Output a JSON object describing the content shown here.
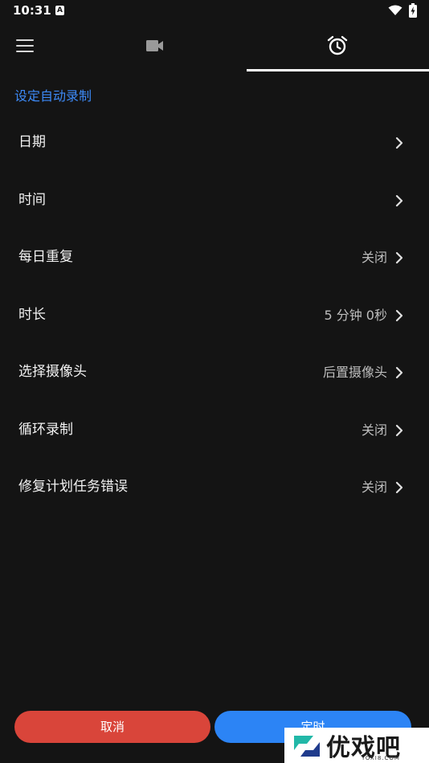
{
  "status_bar": {
    "time": "10:31",
    "notification_icon": "A"
  },
  "tabs": {
    "items": [
      {
        "name": "menu",
        "icon": "menu-icon"
      },
      {
        "name": "camera",
        "icon": "video-camera-icon"
      },
      {
        "name": "timer",
        "icon": "alarm-clock-icon",
        "selected": true
      }
    ]
  },
  "section": {
    "title": "设定自动录制"
  },
  "settings": {
    "rows": [
      {
        "label": "日期",
        "value": ""
      },
      {
        "label": "时间",
        "value": ""
      },
      {
        "label": "每日重复",
        "value": "关闭"
      },
      {
        "label": "时长",
        "value": "5 分钟 0秒"
      },
      {
        "label": "选择摄像头",
        "value": "后置摄像头"
      },
      {
        "label": "循环录制",
        "value": "关闭"
      },
      {
        "label": "修复计划任务错误",
        "value": "关闭"
      }
    ]
  },
  "buttons": {
    "cancel": "取消",
    "schedule": "定时"
  },
  "watermark": {
    "brand": "优戏吧",
    "domain": "YOXI8.COM"
  },
  "colors": {
    "background": "#141414",
    "accent": "#3d8af7",
    "cancel": "#d9453a",
    "confirm": "#2c84f5"
  }
}
